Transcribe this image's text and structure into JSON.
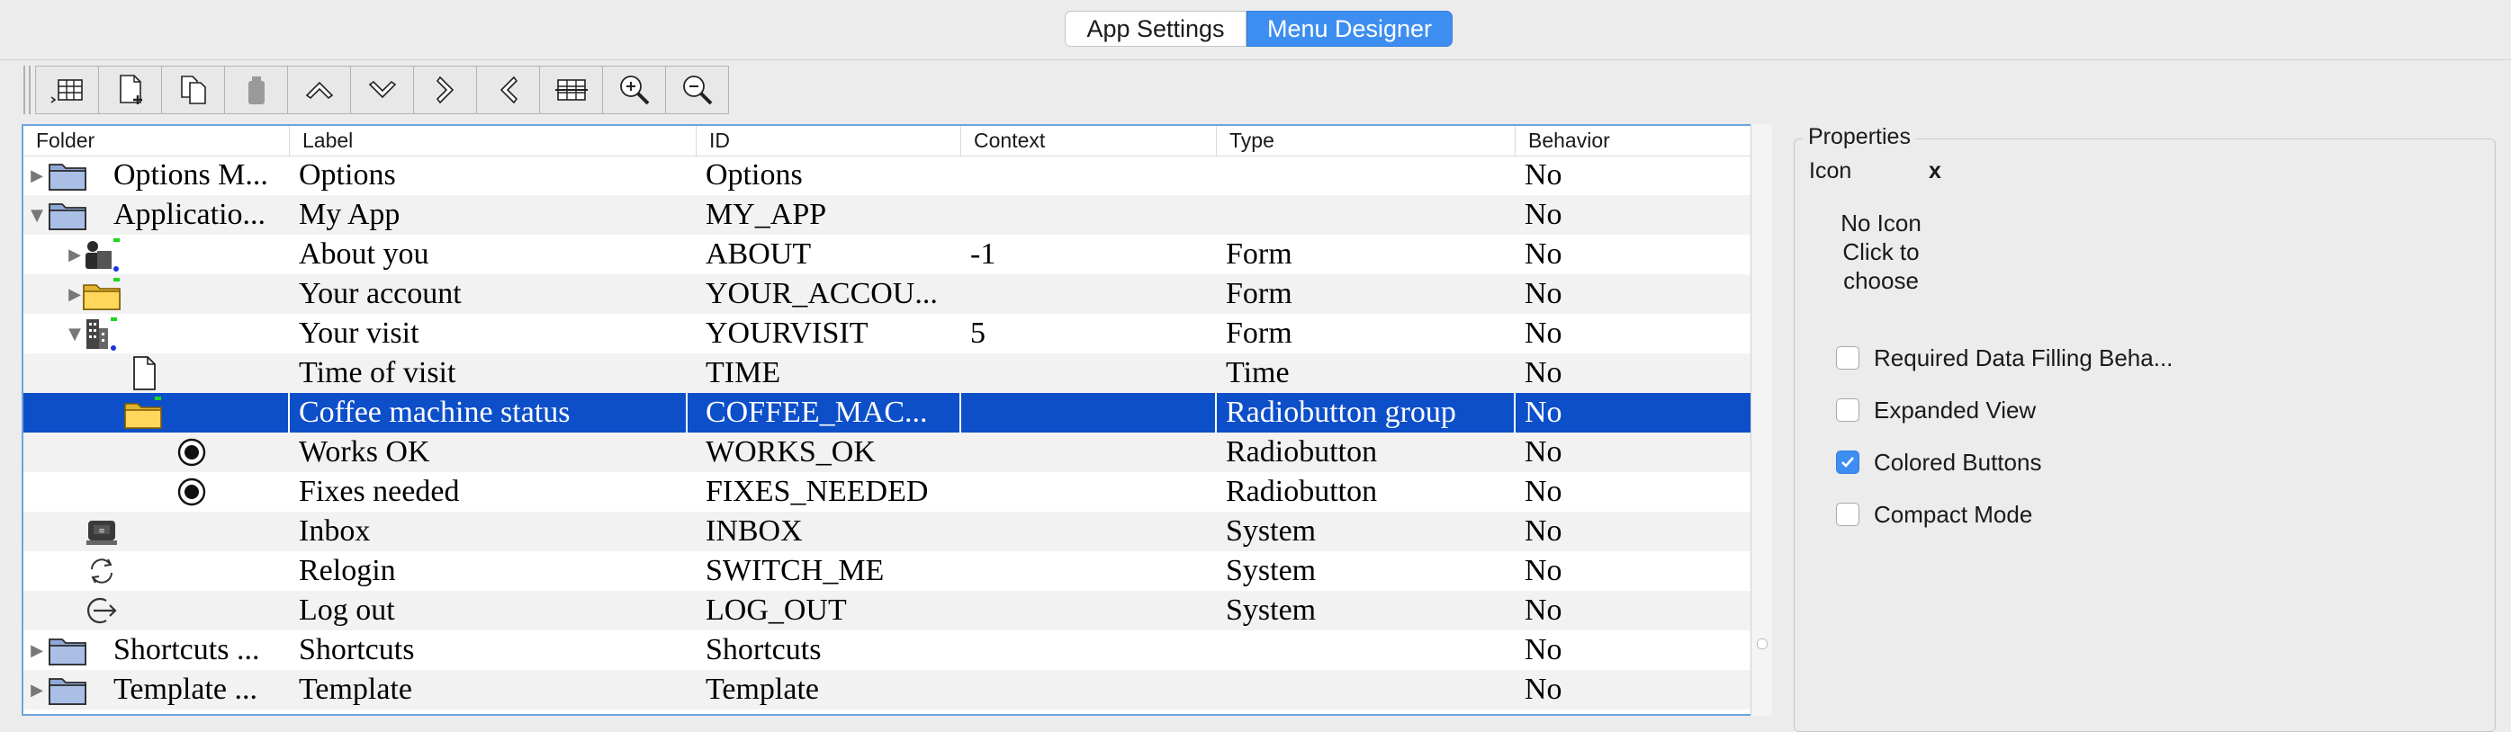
{
  "tabs": [
    {
      "label": "App Settings",
      "active": false
    },
    {
      "label": "Menu Designer",
      "active": true
    }
  ],
  "toolbar": {
    "buttons": [
      {
        "name": "add-root-button",
        "icon": "table-indent-icon"
      },
      {
        "name": "new-item-button",
        "icon": "new-document-icon"
      },
      {
        "name": "copy-button",
        "icon": "copy-icon"
      },
      {
        "name": "delete-button",
        "icon": "trash-icon"
      },
      {
        "name": "move-up-button",
        "icon": "chevron-up-icon"
      },
      {
        "name": "move-down-button",
        "icon": "chevron-down-icon"
      },
      {
        "name": "indent-button",
        "icon": "chevron-right-icon"
      },
      {
        "name": "outdent-button",
        "icon": "chevron-left-icon"
      },
      {
        "name": "table-button",
        "icon": "table-strike-icon"
      },
      {
        "name": "zoom-in-button",
        "icon": "zoom-in-icon"
      },
      {
        "name": "zoom-out-button",
        "icon": "zoom-out-icon"
      }
    ]
  },
  "tree": {
    "columns": [
      "Folder",
      "Label",
      "ID",
      "Context",
      "Type",
      "Behavior"
    ],
    "rows": [
      {
        "folder": "Options M...",
        "label": "Options",
        "id": "Options",
        "context": "",
        "type": "",
        "behavior": "No",
        "icon": "folder-icon",
        "toggle": "▶"
      },
      {
        "folder": "Applicatio...",
        "label": "My App",
        "id": "MY_APP",
        "context": "",
        "type": "",
        "behavior": "No",
        "icon": "folder-icon",
        "toggle": "▼"
      },
      {
        "folder": "",
        "label": "About you",
        "id": "ABOUT",
        "context": "-1",
        "type": "Form",
        "behavior": "No",
        "icon": "person-form-icon",
        "toggle": "▶"
      },
      {
        "folder": "",
        "label": "Your account",
        "id": "YOUR_ACCOU...",
        "context": "",
        "type": "Form",
        "behavior": "No",
        "icon": "yellow-folder-icon",
        "toggle": "▶"
      },
      {
        "folder": "",
        "label": "Your visit",
        "id": "YOURVISIT",
        "context": "5",
        "type": "Form",
        "behavior": "No",
        "icon": "building-icon",
        "toggle": "▼"
      },
      {
        "folder": "",
        "label": "Time of visit",
        "id": "TIME",
        "context": "",
        "type": "Time",
        "behavior": "No",
        "icon": "document-icon",
        "toggle": ""
      },
      {
        "folder": "",
        "label": "Coffee machine status",
        "id": "COFFEE_MAC...",
        "context": "",
        "type": "Radiobutton group",
        "behavior": "No",
        "icon": "yellow-folder-icon",
        "toggle": "▼",
        "selected": true
      },
      {
        "folder": "",
        "label": "Works OK",
        "id": "WORKS_OK",
        "context": "",
        "type": "Radiobutton",
        "behavior": "No",
        "icon": "radio-icon",
        "toggle": ""
      },
      {
        "folder": "",
        "label": "Fixes needed",
        "id": "FIXES_NEEDED",
        "context": "",
        "type": "Radiobutton",
        "behavior": "No",
        "icon": "radio-icon",
        "toggle": ""
      },
      {
        "folder": "",
        "label": "Inbox",
        "id": "INBOX",
        "context": "",
        "type": "System",
        "behavior": "No",
        "icon": "inbox-icon",
        "toggle": ""
      },
      {
        "folder": "",
        "label": "Relogin",
        "id": "SWITCH_ME",
        "context": "",
        "type": "System",
        "behavior": "No",
        "icon": "relogin-icon",
        "toggle": ""
      },
      {
        "folder": "",
        "label": "Log out",
        "id": "LOG_OUT",
        "context": "",
        "type": "System",
        "behavior": "No",
        "icon": "logout-icon",
        "toggle": ""
      },
      {
        "folder": "Shortcuts ...",
        "label": "Shortcuts",
        "id": "Shortcuts",
        "context": "",
        "type": "",
        "behavior": "No",
        "icon": "folder-icon",
        "toggle": "▶"
      },
      {
        "folder": "Template ...",
        "label": "Template",
        "id": "Template",
        "context": "",
        "type": "",
        "behavior": "No",
        "icon": "folder-icon",
        "toggle": "▶"
      }
    ]
  },
  "properties": {
    "title": "Properties",
    "icon_label": "Icon",
    "icon_clear": "x",
    "no_icon_lines": [
      "No Icon",
      "Click to",
      "choose"
    ],
    "checkboxes": [
      {
        "label": "Required Data Filling Beha...",
        "checked": false
      },
      {
        "label": "Expanded View",
        "checked": false
      },
      {
        "label": "Colored Buttons",
        "checked": true
      },
      {
        "label": "Compact Mode",
        "checked": false
      }
    ]
  },
  "colors": {
    "accent": "#3d8ef0",
    "selection": "#0d4fc9"
  }
}
